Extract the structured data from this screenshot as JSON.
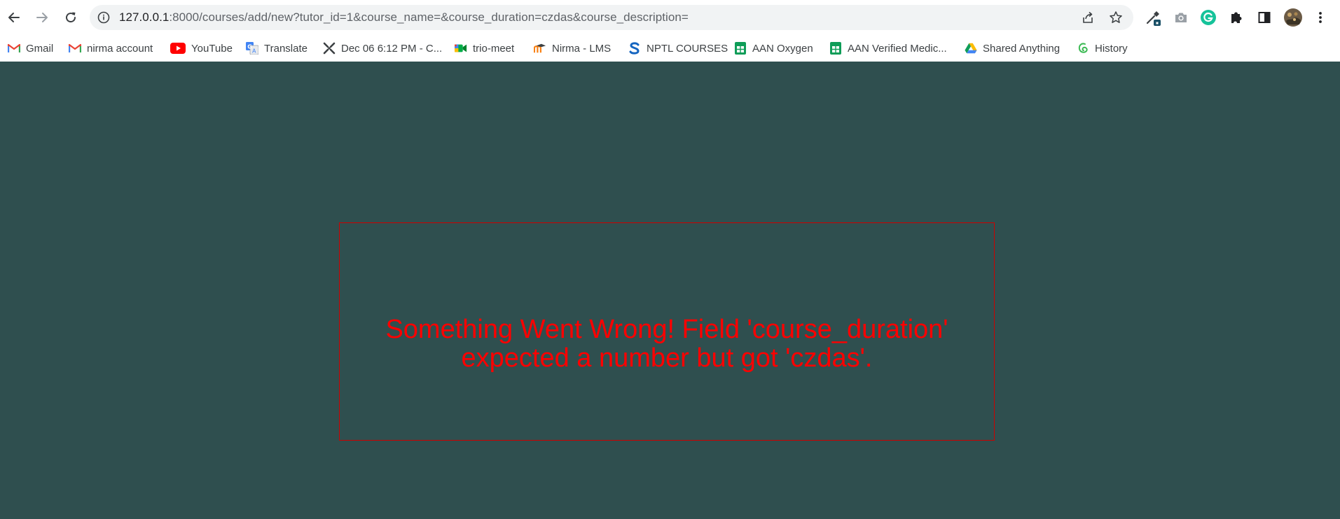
{
  "browser": {
    "url_host": "127.0.0.1",
    "url_rest": ":8000/courses/add/new?tutor_id=1&course_name=&course_duration=czdas&course_description=",
    "nav_icons": [
      "back-arrow-icon",
      "forward-arrow-icon",
      "reload-icon"
    ],
    "omnibox_icons": [
      "info-icon",
      "share-icon",
      "star-icon"
    ],
    "extension_icons": [
      "eyedropper-icon",
      "camera-icon",
      "grammarly-icon",
      "puzzle-icon",
      "side-panel-icon",
      "profile-avatar",
      "kebab-menu-icon"
    ]
  },
  "bookmarks": [
    {
      "label": "Gmail",
      "icon": "gmail-icon"
    },
    {
      "label": "nirma account",
      "icon": "gmail-icon"
    },
    {
      "label": "YouTube",
      "icon": "youtube-icon"
    },
    {
      "label": "Translate",
      "icon": "translate-icon"
    },
    {
      "label": "Dec 06 6:12 PM - C...",
      "icon": "clock-x-icon"
    },
    {
      "label": "trio-meet",
      "icon": "meet-icon"
    },
    {
      "label": "Nirma - LMS",
      "icon": "moodle-icon"
    },
    {
      "label": "NPTL COURSES",
      "icon": "swayam-icon"
    },
    {
      "label": "AAN Oxygen",
      "icon": "sheets-icon"
    },
    {
      "label": "AAN Verified Medic...",
      "icon": "sheets-icon"
    },
    {
      "label": "Shared Anything",
      "icon": "drive-icon"
    },
    {
      "label": "History",
      "icon": "history-icon"
    }
  ],
  "page": {
    "error_message": "Something Went Wrong! Field 'course_duration' expected a number but got 'czdas'.",
    "background_color": "#2f4f4f",
    "error_color": "#ff0000"
  }
}
